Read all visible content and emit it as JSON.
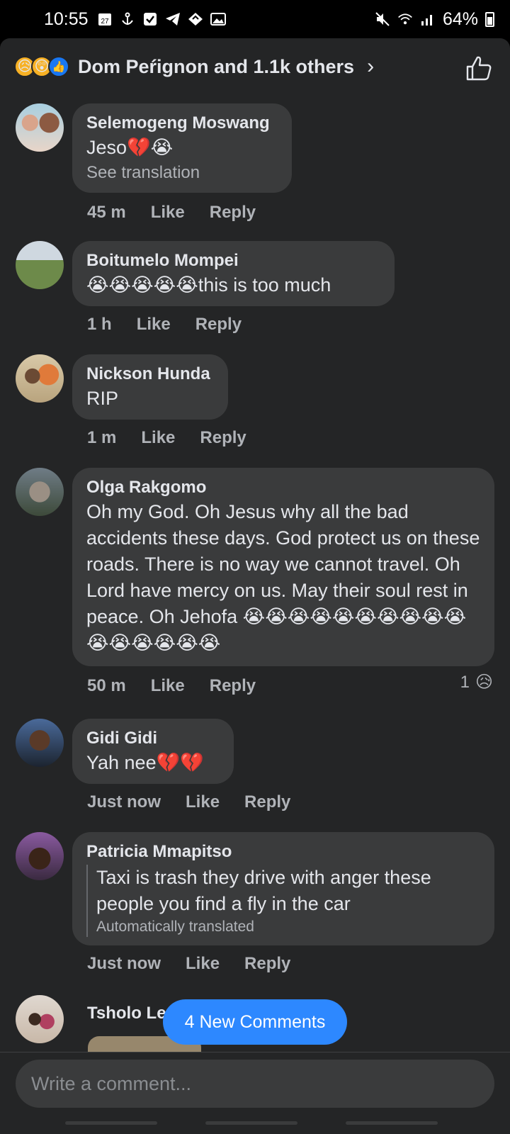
{
  "status_bar": {
    "time": "10:55",
    "battery": "64%",
    "calendar_day": "27",
    "icons": [
      "calendar-icon",
      "anchor-icon",
      "checkbox-icon",
      "telegram-icon",
      "diamond-icon",
      "image-icon"
    ],
    "right_icons": [
      "mute-icon",
      "wifi-icon",
      "signal-icon",
      "battery-icon"
    ]
  },
  "reactions": {
    "summary": "Dom Peŕignon and 1.1k others",
    "icons": [
      "sad-react-icon",
      "wow-react-icon",
      "like-react-icon"
    ]
  },
  "comments": [
    {
      "author": "Selemogeng Moswang",
      "text": "Jeso💔😭",
      "sub": "See translation",
      "time": "45 m",
      "like": "Like",
      "reply": "Reply"
    },
    {
      "author": "Boitumelo Mompei",
      "text": "😭😭😭😭😭this is too much",
      "time": "1 h",
      "like": "Like",
      "reply": "Reply"
    },
    {
      "author": "Nickson Hunda",
      "text": "RIP",
      "time": "1 m",
      "like": "Like",
      "reply": "Reply"
    },
    {
      "author": "Olga Rakgomo",
      "text": "Oh my God. Oh Jesus why all the bad accidents these days. God protect us on these roads. There is no way we cannot travel. Oh Lord have mercy on us. May their soul rest in peace. Oh Jehofa 😭😭😭😭😭😭😭😭😭😭😭😭😭😭😭😭",
      "time": "50 m",
      "like": "Like",
      "reply": "Reply",
      "reaction_count": "1",
      "reaction_emoji": "😥"
    },
    {
      "author": "Gidi Gidi",
      "text": "Yah nee💔💔",
      "time": "Just now",
      "like": "Like",
      "reply": "Reply"
    },
    {
      "author": "Patricia Mmapitso",
      "text": "Taxi is trash they drive with anger these people you find a fly in the car",
      "sub": "Automatically translated",
      "time": "Just now",
      "like": "Like",
      "reply": "Reply"
    },
    {
      "author": "Tsholo Le"
    }
  ],
  "new_comments_label": "4 New Comments",
  "composer": {
    "placeholder": "Write a comment..."
  },
  "colors": {
    "accent": "#2d88ff",
    "bubble": "#3a3b3c",
    "sheet": "#242526"
  }
}
